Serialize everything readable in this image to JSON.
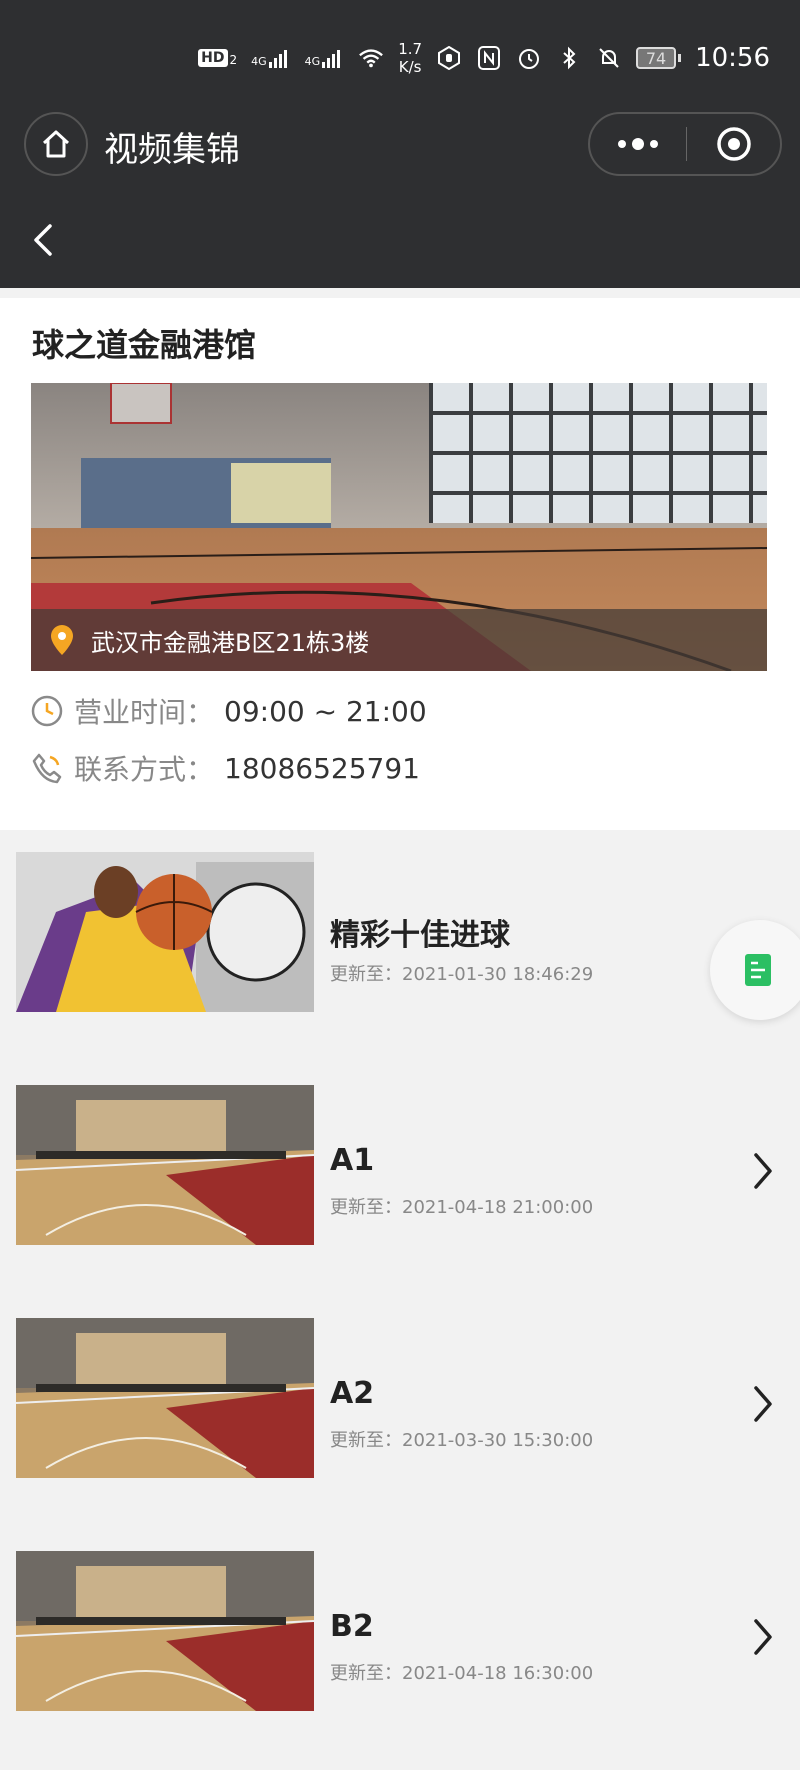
{
  "status_bar": {
    "network_speed_value": "1.7",
    "network_speed_unit": "K/s",
    "battery": "74",
    "time": "10:56",
    "hd_label": "HD",
    "hd_sub": "2",
    "signal_labels": [
      "4G",
      "4G"
    ]
  },
  "navbar": {
    "title": "视频集锦"
  },
  "venue": {
    "name": "球之道金融港馆",
    "address": "武汉市金融港B区21栋3楼",
    "hours_label": "营业时间：",
    "hours_value": "09:00 ~ 21:00",
    "contact_label": "联系方式：",
    "contact_value": "18086525791"
  },
  "videos": [
    {
      "title": "精彩十佳进球",
      "updated": "更新至：2021-01-30 18:46:29"
    },
    {
      "title": "A1",
      "updated": "更新至：2021-04-18 21:00:00"
    },
    {
      "title": "A2",
      "updated": "更新至：2021-03-30 15:30:00"
    },
    {
      "title": "B2",
      "updated": "更新至：2021-04-18 16:30:00"
    }
  ],
  "colors": {
    "header_bg": "#2e2f31",
    "accent_orange": "#f5a623",
    "float_green": "#2bbf63"
  }
}
